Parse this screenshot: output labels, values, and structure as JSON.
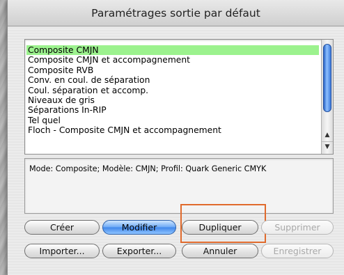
{
  "dialog": {
    "title": "Paramétrages sortie par défaut"
  },
  "list": {
    "items": [
      "Composite CMJN",
      "Composite CMJN et accompagnement",
      "Composite RVB",
      "Conv. en coul. de séparation",
      "Coul. séparation et accomp.",
      "Niveaux de gris",
      "Séparations In-RIP",
      "Tel quel",
      "Floch - Composite CMJN et accompagnement"
    ],
    "selected_index": 0,
    "scroll_up_icon": "▲",
    "scroll_down_icon": "▼"
  },
  "info": {
    "text": "Mode: Composite; Modèle: CMJN; Profil: Quark Generic CMYK"
  },
  "buttons": {
    "creer": "Créer",
    "modifier": "Modifier",
    "dupliquer": "Dupliquer",
    "supprimer": "Supprimer",
    "importer": "Importer...",
    "exporter": "Exporter...",
    "annuler": "Annuler",
    "enregistrer": "Enregistrer"
  },
  "colors": {
    "selection": "#9cf28e",
    "default_button": "#3f86ea",
    "highlight_box": "#e06a2c"
  }
}
